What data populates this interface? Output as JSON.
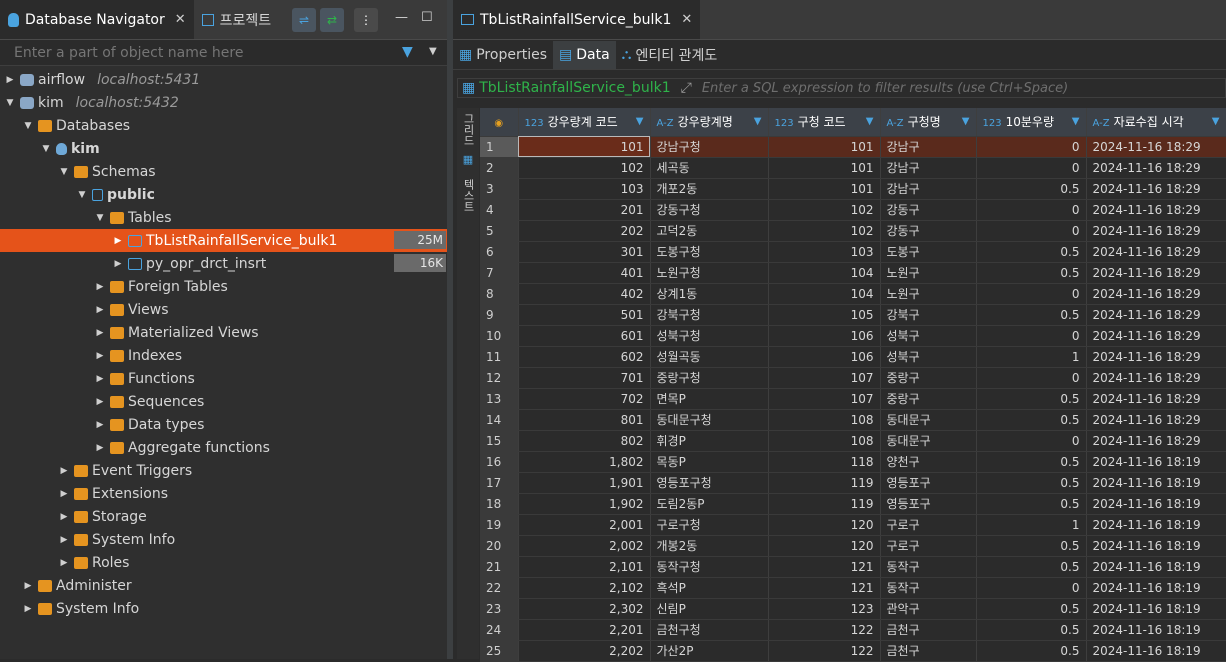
{
  "left_tabs": [
    {
      "label": "Database Navigator",
      "icon": "database-icon"
    },
    {
      "label": "프로젝트",
      "icon": "project-icon"
    }
  ],
  "filter": {
    "placeholder": "Enter a part of object name here"
  },
  "tree": {
    "airflow": {
      "label": "airflow",
      "host": "localhost:5431"
    },
    "kim": {
      "label": "kim",
      "host": "localhost:5432"
    },
    "databases": "Databases",
    "kim_db": "kim",
    "schemas": "Schemas",
    "public": "public",
    "tables": "Tables",
    "table1": {
      "label": "TbListRainfallService_bulk1",
      "size": "25M"
    },
    "table2": {
      "label": "py_opr_drct_insrt",
      "size": "16K"
    },
    "foreign_tables": "Foreign Tables",
    "views": "Views",
    "mat_views": "Materialized Views",
    "indexes": "Indexes",
    "functions": "Functions",
    "sequences": "Sequences",
    "data_types": "Data types",
    "aggregate": "Aggregate functions",
    "event_triggers": "Event Triggers",
    "extensions": "Extensions",
    "storage": "Storage",
    "system_info_db": "System Info",
    "roles": "Roles",
    "administer": "Administer",
    "system_info": "System Info"
  },
  "editor_tab": "TbListRainfallService_bulk1",
  "subtabs": [
    "Properties",
    "Data",
    "엔티티 관계도"
  ],
  "sqlbar": {
    "table": "TbListRainfallService_bulk1",
    "hint": "Enter a SQL expression to filter results (use Ctrl+Space)"
  },
  "vtabs": [
    "그리드",
    "텍스트"
  ],
  "columns": [
    {
      "type": "123",
      "name": "강우량계 코드"
    },
    {
      "type": "A-Z",
      "name": "강우량계명"
    },
    {
      "type": "123",
      "name": "구청 코드"
    },
    {
      "type": "A-Z",
      "name": "구청명"
    },
    {
      "type": "123",
      "name": "10분우량"
    },
    {
      "type": "A-Z",
      "name": "자료수집 시각"
    }
  ],
  "rows": [
    [
      "1",
      "101",
      "강남구청",
      "101",
      "강남구",
      "0",
      "2024-11-16 18:29"
    ],
    [
      "2",
      "102",
      "세곡동",
      "101",
      "강남구",
      "0",
      "2024-11-16 18:29"
    ],
    [
      "3",
      "103",
      "개포2동",
      "101",
      "강남구",
      "0.5",
      "2024-11-16 18:29"
    ],
    [
      "4",
      "201",
      "강동구청",
      "102",
      "강동구",
      "0",
      "2024-11-16 18:29"
    ],
    [
      "5",
      "202",
      "고덕2동",
      "102",
      "강동구",
      "0",
      "2024-11-16 18:29"
    ],
    [
      "6",
      "301",
      "도봉구청",
      "103",
      "도봉구",
      "0.5",
      "2024-11-16 18:29"
    ],
    [
      "7",
      "401",
      "노원구청",
      "104",
      "노원구",
      "0.5",
      "2024-11-16 18:29"
    ],
    [
      "8",
      "402",
      "상계1동",
      "104",
      "노원구",
      "0",
      "2024-11-16 18:29"
    ],
    [
      "9",
      "501",
      "강북구청",
      "105",
      "강북구",
      "0.5",
      "2024-11-16 18:29"
    ],
    [
      "10",
      "601",
      "성북구청",
      "106",
      "성북구",
      "0",
      "2024-11-16 18:29"
    ],
    [
      "11",
      "602",
      "성월곡동",
      "106",
      "성북구",
      "1",
      "2024-11-16 18:29"
    ],
    [
      "12",
      "701",
      "중랑구청",
      "107",
      "중랑구",
      "0",
      "2024-11-16 18:29"
    ],
    [
      "13",
      "702",
      "면목P",
      "107",
      "중랑구",
      "0.5",
      "2024-11-16 18:29"
    ],
    [
      "14",
      "801",
      "동대문구청",
      "108",
      "동대문구",
      "0.5",
      "2024-11-16 18:29"
    ],
    [
      "15",
      "802",
      "휘경P",
      "108",
      "동대문구",
      "0",
      "2024-11-16 18:29"
    ],
    [
      "16",
      "1,802",
      "목동P",
      "118",
      "양천구",
      "0.5",
      "2024-11-16 18:19"
    ],
    [
      "17",
      "1,901",
      "영등포구청",
      "119",
      "영등포구",
      "0.5",
      "2024-11-16 18:19"
    ],
    [
      "18",
      "1,902",
      "도림2동P",
      "119",
      "영등포구",
      "0.5",
      "2024-11-16 18:19"
    ],
    [
      "19",
      "2,001",
      "구로구청",
      "120",
      "구로구",
      "1",
      "2024-11-16 18:19"
    ],
    [
      "20",
      "2,002",
      "개봉2동",
      "120",
      "구로구",
      "0.5",
      "2024-11-16 18:19"
    ],
    [
      "21",
      "2,101",
      "동작구청",
      "121",
      "동작구",
      "0.5",
      "2024-11-16 18:19"
    ],
    [
      "22",
      "2,102",
      "흑석P",
      "121",
      "동작구",
      "0",
      "2024-11-16 18:19"
    ],
    [
      "23",
      "2,302",
      "신림P",
      "123",
      "관악구",
      "0.5",
      "2024-11-16 18:19"
    ],
    [
      "24",
      "2,201",
      "금천구청",
      "122",
      "금천구",
      "0.5",
      "2024-11-16 18:19"
    ],
    [
      "25",
      "2,202",
      "가산2P",
      "122",
      "금천구",
      "0.5",
      "2024-11-16 18:19"
    ]
  ]
}
